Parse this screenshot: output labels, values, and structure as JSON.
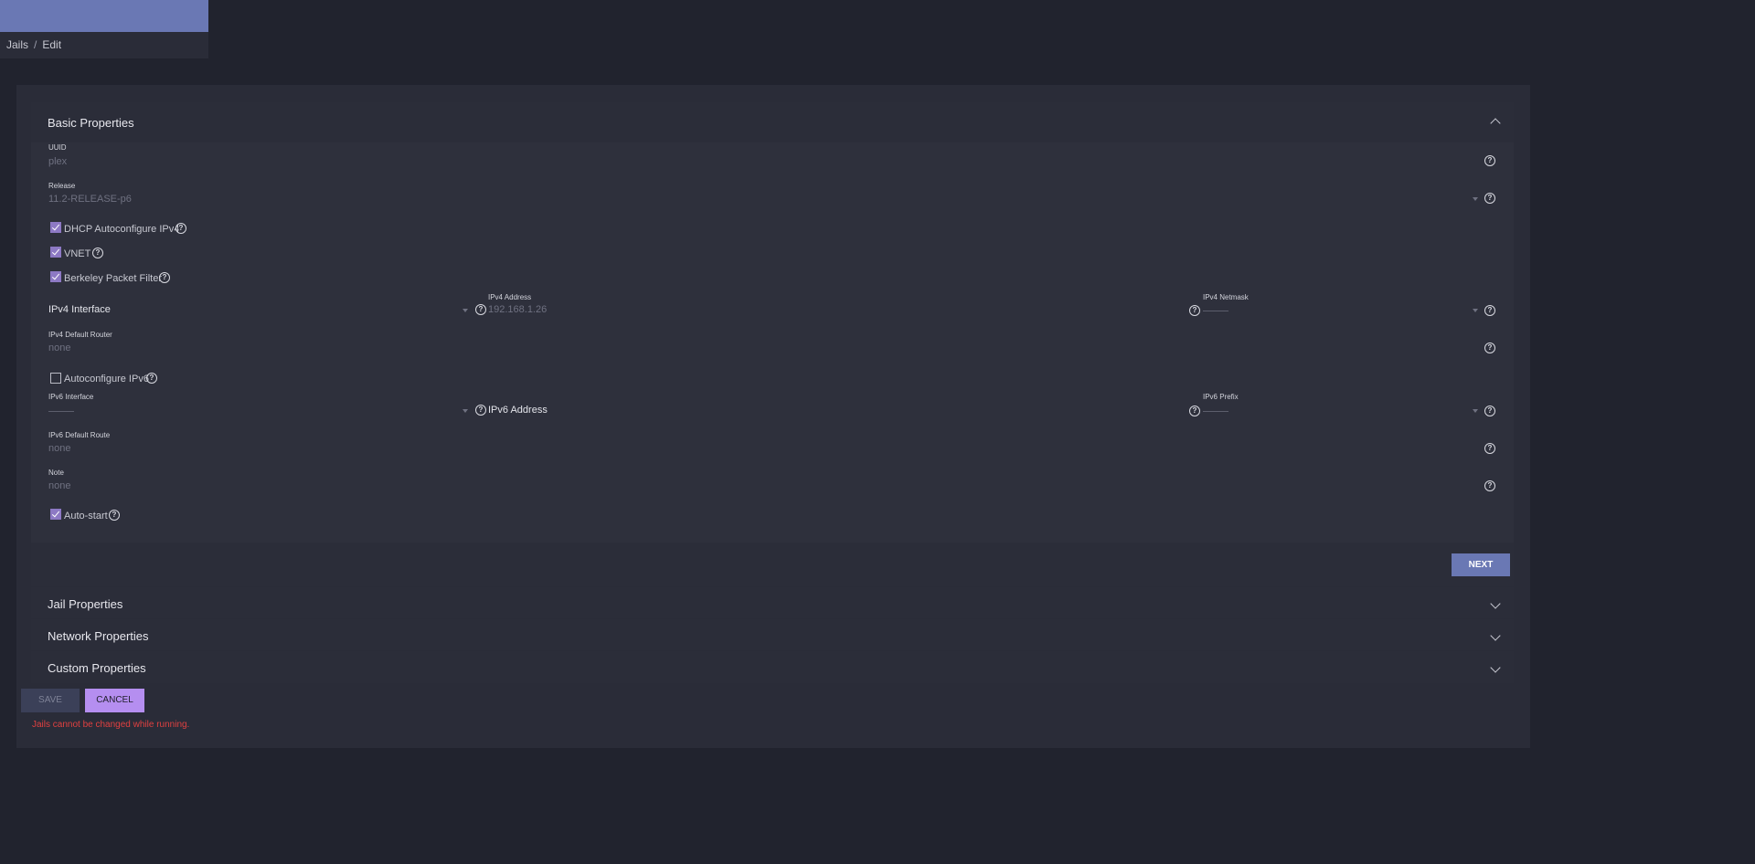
{
  "breadcrumb": {
    "parent": "Jails",
    "separator": "/",
    "current": "Edit"
  },
  "sections": {
    "basic": "Basic Properties",
    "jail": "Jail Properties",
    "network": "Network Properties",
    "custom": "Custom Properties"
  },
  "fields": {
    "uuid": {
      "label": "UUID",
      "value": "plex"
    },
    "release": {
      "label": "Release",
      "value": "11.2-RELEASE-p6"
    },
    "dhcp": {
      "label": "DHCP Autoconfigure IPv4",
      "checked": true
    },
    "vnet": {
      "label": "VNET",
      "checked": true
    },
    "bpf": {
      "label": "Berkeley Packet Filter",
      "checked": true
    },
    "ipv4_interface": {
      "label": "IPv4 Interface"
    },
    "ipv4_address": {
      "label": "IPv4 Address",
      "value": "192.168.1.26"
    },
    "ipv4_netmask": {
      "label": "IPv4 Netmask",
      "value": "------"
    },
    "ipv4_router": {
      "label": "IPv4 Default Router",
      "value": "none"
    },
    "autoconf_ipv6": {
      "label": "Autoconfigure IPv6",
      "checked": false
    },
    "ipv6_interface": {
      "label": "IPv6 Interface",
      "value": "------"
    },
    "ipv6_address": {
      "label": "IPv6 Address"
    },
    "ipv6_prefix": {
      "label": "IPv6 Prefix",
      "value": "------"
    },
    "ipv6_route": {
      "label": "IPv6 Default Route",
      "value": "none"
    },
    "note": {
      "label": "Note",
      "value": "none"
    },
    "autostart": {
      "label": "Auto-start",
      "checked": true
    }
  },
  "buttons": {
    "next": "NEXT",
    "save": "SAVE",
    "cancel": "CANCEL"
  },
  "error": "Jails cannot be changed while running.",
  "icons": {
    "help": "?"
  },
  "colors": {
    "accent": "#6a78b4",
    "checkbox": "#8d79c4",
    "cancel": "#b58ef0",
    "error": "#e04040"
  }
}
